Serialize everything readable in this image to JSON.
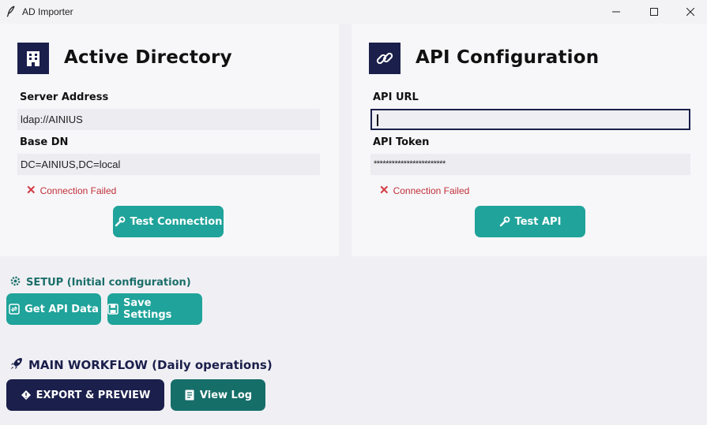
{
  "window": {
    "title": "AD Importer",
    "app_icon": "feather-icon",
    "controls": [
      "minimize",
      "maximize",
      "close"
    ]
  },
  "active_directory": {
    "icon": "building-icon",
    "title": "Active Directory",
    "server_address_label": "Server Address",
    "server_address_value": "ldap://AINIUS",
    "base_dn_label": "Base DN",
    "base_dn_value": "DC=AINIUS,DC=local",
    "status_text": "Connection Failed",
    "test_button_label": "Test Connection"
  },
  "api_configuration": {
    "icon": "link-icon",
    "title": "API Configuration",
    "api_url_label": "API URL",
    "api_url_value": "",
    "api_token_label": "API Token",
    "api_token_value": "************************",
    "status_text": "Connection Failed",
    "test_button_label": "Test API"
  },
  "setup": {
    "heading": "SETUP (Initial configuration)",
    "get_api_data_label": "Get API Data",
    "save_settings_label": "Save Settings"
  },
  "main_workflow": {
    "heading": "MAIN WORKFLOW (Daily operations)",
    "export_preview_label": "EXPORT & PREVIEW",
    "view_log_label": "View Log"
  },
  "colors": {
    "navy": "#1b1f4b",
    "teal": "#1fa39a",
    "dark_teal": "#166e69",
    "error_red": "#c0303a"
  }
}
